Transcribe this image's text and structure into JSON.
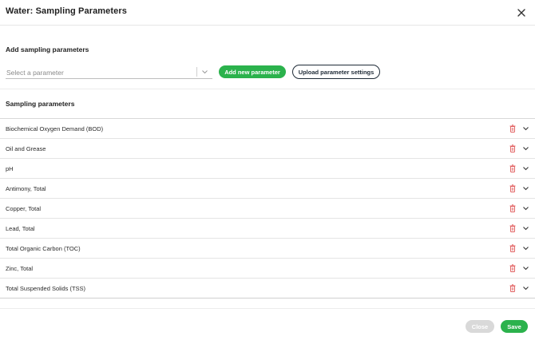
{
  "modal": {
    "title": "Water: Sampling Parameters"
  },
  "add_section": {
    "title": "Add sampling parameters",
    "select_placeholder": "Select a parameter",
    "add_button_label": "Add new parameter",
    "upload_button_label": "Upload parameter settings"
  },
  "list_section": {
    "title": "Sampling parameters",
    "items": [
      {
        "label": "Biochemical Oxygen Demand (BOD)"
      },
      {
        "label": "Oil and Grease"
      },
      {
        "label": "pH"
      },
      {
        "label": "Antimony, Total"
      },
      {
        "label": "Copper, Total"
      },
      {
        "label": "Lead, Total"
      },
      {
        "label": "Total Organic Carbon (TOC)"
      },
      {
        "label": "Zinc, Total"
      },
      {
        "label": "Total Suspended Solids (TSS)"
      }
    ]
  },
  "footer": {
    "close_label": "Close",
    "save_label": "Save"
  },
  "colors": {
    "primary_green": "#2bb24c",
    "delete_red": "#e05a5a",
    "dark_outline": "#1f2b37",
    "disabled_gray": "#d9d9d9"
  },
  "icons": {
    "close": "close-icon",
    "select_chevron": "chevron-down-icon",
    "row_delete": "trash-icon",
    "row_expand": "chevron-down-icon"
  }
}
